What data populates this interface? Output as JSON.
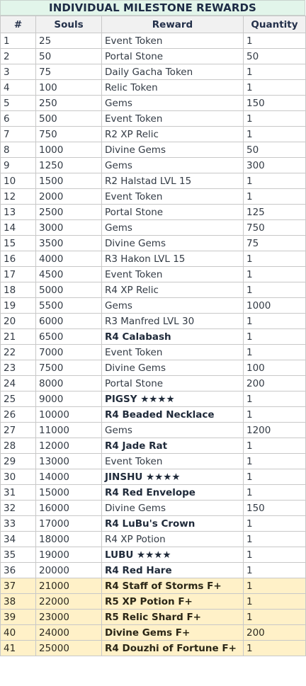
{
  "title": "INDIVIDUAL MILESTONE REWARDS",
  "headers": [
    "#",
    "Souls",
    "Reward",
    "Quantity"
  ],
  "colors": {
    "title_bg": "#e2f5ea",
    "header_bg": "#f1f1f1",
    "highlight_bg": "#fff1c8"
  },
  "rows": [
    {
      "num": "1",
      "souls": "25",
      "reward": "Event Token",
      "qty": "1",
      "bold": false,
      "highlight": false
    },
    {
      "num": "2",
      "souls": "50",
      "reward": "Portal Stone",
      "qty": "50",
      "bold": false,
      "highlight": false
    },
    {
      "num": "3",
      "souls": "75",
      "reward": "Daily Gacha Token",
      "qty": "1",
      "bold": false,
      "highlight": false
    },
    {
      "num": "4",
      "souls": "100",
      "reward": "Relic Token",
      "qty": "1",
      "bold": false,
      "highlight": false
    },
    {
      "num": "5",
      "souls": "250",
      "reward": "Gems",
      "qty": "150",
      "bold": false,
      "highlight": false
    },
    {
      "num": "6",
      "souls": "500",
      "reward": "Event Token",
      "qty": "1",
      "bold": false,
      "highlight": false
    },
    {
      "num": "7",
      "souls": "750",
      "reward": "R2 XP Relic",
      "qty": "1",
      "bold": false,
      "highlight": false
    },
    {
      "num": "8",
      "souls": "1000",
      "reward": "Divine Gems",
      "qty": "50",
      "bold": false,
      "highlight": false
    },
    {
      "num": "9",
      "souls": "1250",
      "reward": "Gems",
      "qty": "300",
      "bold": false,
      "highlight": false
    },
    {
      "num": "10",
      "souls": "1500",
      "reward": "R2 Halstad LVL 15",
      "qty": "1",
      "bold": false,
      "highlight": false
    },
    {
      "num": "12",
      "souls": "2000",
      "reward": "Event Token",
      "qty": "1",
      "bold": false,
      "highlight": false
    },
    {
      "num": "13",
      "souls": "2500",
      "reward": "Portal Stone",
      "qty": "125",
      "bold": false,
      "highlight": false
    },
    {
      "num": "14",
      "souls": "3000",
      "reward": "Gems",
      "qty": "750",
      "bold": false,
      "highlight": false
    },
    {
      "num": "15",
      "souls": "3500",
      "reward": "Divine Gems",
      "qty": "75",
      "bold": false,
      "highlight": false
    },
    {
      "num": "16",
      "souls": "4000",
      "reward": "R3 Hakon LVL 15",
      "qty": "1",
      "bold": false,
      "highlight": false
    },
    {
      "num": "17",
      "souls": "4500",
      "reward": "Event Token",
      "qty": "1",
      "bold": false,
      "highlight": false
    },
    {
      "num": "18",
      "souls": "5000",
      "reward": "R4 XP Relic",
      "qty": "1",
      "bold": false,
      "highlight": false
    },
    {
      "num": "19",
      "souls": "5500",
      "reward": "Gems",
      "qty": "1000",
      "bold": false,
      "highlight": false
    },
    {
      "num": "20",
      "souls": "6000",
      "reward": "R3 Manfred LVL 30",
      "qty": "1",
      "bold": false,
      "highlight": false
    },
    {
      "num": "21",
      "souls": "6500",
      "reward": "R4 Calabash",
      "qty": "1",
      "bold": true,
      "highlight": false
    },
    {
      "num": "22",
      "souls": "7000",
      "reward": "Event Token",
      "qty": "1",
      "bold": false,
      "highlight": false
    },
    {
      "num": "23",
      "souls": "7500",
      "reward": "Divine Gems",
      "qty": "100",
      "bold": false,
      "highlight": false
    },
    {
      "num": "24",
      "souls": "8000",
      "reward": "Portal Stone",
      "qty": "200",
      "bold": false,
      "highlight": false
    },
    {
      "num": "25",
      "souls": "9000",
      "reward": "PIGSY ★★★★",
      "qty": "1",
      "bold": true,
      "highlight": false
    },
    {
      "num": "26",
      "souls": "10000",
      "reward": "R4 Beaded Necklace",
      "qty": "1",
      "bold": true,
      "highlight": false
    },
    {
      "num": "27",
      "souls": "11000",
      "reward": "Gems",
      "qty": "1200",
      "bold": false,
      "highlight": false
    },
    {
      "num": "28",
      "souls": "12000",
      "reward": "R4 Jade Rat",
      "qty": "1",
      "bold": true,
      "highlight": false
    },
    {
      "num": "29",
      "souls": "13000",
      "reward": "Event Token",
      "qty": "1",
      "bold": false,
      "highlight": false
    },
    {
      "num": "30",
      "souls": "14000",
      "reward": "JINSHU ★★★★",
      "qty": "1",
      "bold": true,
      "highlight": false
    },
    {
      "num": "31",
      "souls": "15000",
      "reward": "R4 Red Envelope",
      "qty": "1",
      "bold": true,
      "highlight": false
    },
    {
      "num": "32",
      "souls": "16000",
      "reward": "Divine Gems",
      "qty": "150",
      "bold": false,
      "highlight": false
    },
    {
      "num": "33",
      "souls": "17000",
      "reward": "R4 LuBu's Crown",
      "qty": "1",
      "bold": true,
      "highlight": false
    },
    {
      "num": "34",
      "souls": "18000",
      "reward": "R4 XP Potion",
      "qty": "1",
      "bold": false,
      "highlight": false
    },
    {
      "num": "35",
      "souls": "19000",
      "reward": "LUBU ★★★★",
      "qty": "1",
      "bold": true,
      "highlight": false
    },
    {
      "num": "36",
      "souls": "20000",
      "reward": "R4 Red Hare",
      "qty": "1",
      "bold": true,
      "highlight": false
    },
    {
      "num": "37",
      "souls": "21000",
      "reward": "R4 Staff of Storms F+",
      "qty": "1",
      "bold": true,
      "highlight": true
    },
    {
      "num": "38",
      "souls": "22000",
      "reward": "R5 XP Potion F+",
      "qty": "1",
      "bold": true,
      "highlight": true
    },
    {
      "num": "39",
      "souls": "23000",
      "reward": "R5 Relic Shard F+",
      "qty": "1",
      "bold": true,
      "highlight": true
    },
    {
      "num": "40",
      "souls": "24000",
      "reward": "Divine Gems F+",
      "qty": "200",
      "bold": true,
      "highlight": true
    },
    {
      "num": "41",
      "souls": "25000",
      "reward": "R4 Douzhi of Fortune F+",
      "qty": "1",
      "bold": true,
      "highlight": true
    }
  ]
}
